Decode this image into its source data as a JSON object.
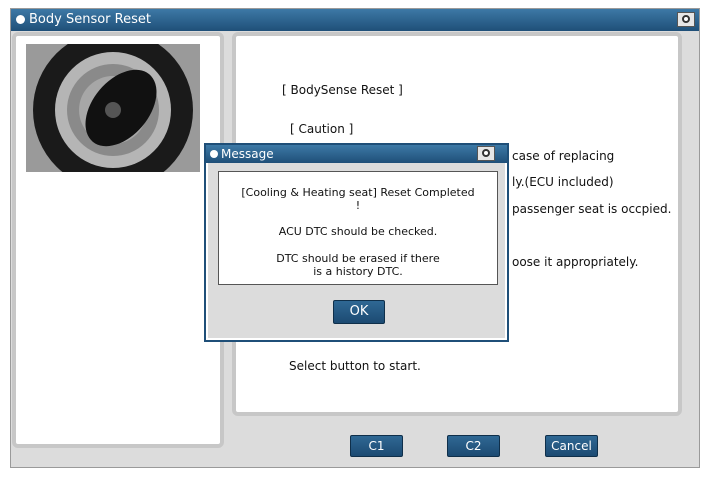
{
  "window": {
    "title": "Body Sensor Reset"
  },
  "content": {
    "header": "[ BodySense Reset ]",
    "caution": "[ Caution ]",
    "line1": "case of replacing",
    "line2": "ly.(ECU included)",
    "line3": "passenger seat is occpied.",
    "line4": "oose it appropriately.",
    "select_text": "Select button to start."
  },
  "buttons": {
    "c1": "C1",
    "c2": "C2",
    "cancel": "Cancel"
  },
  "dialog": {
    "title": "Message",
    "msg_line1": "[Cooling & Heating seat] Reset Completed",
    "msg_line2": "!",
    "msg_line3": "ACU DTC should be checked.",
    "msg_line4": "DTC should be erased if there",
    "msg_line5": "is a history DTC.",
    "ok_label": "OK"
  },
  "icons": {
    "title_icon": "camera-icon",
    "dialog_icon": "camera-icon"
  },
  "colors": {
    "titlebar": "#1f4f78",
    "button": "#1c4a72",
    "panel_border": "#c7c7c7",
    "background": "#dcdcdc"
  }
}
